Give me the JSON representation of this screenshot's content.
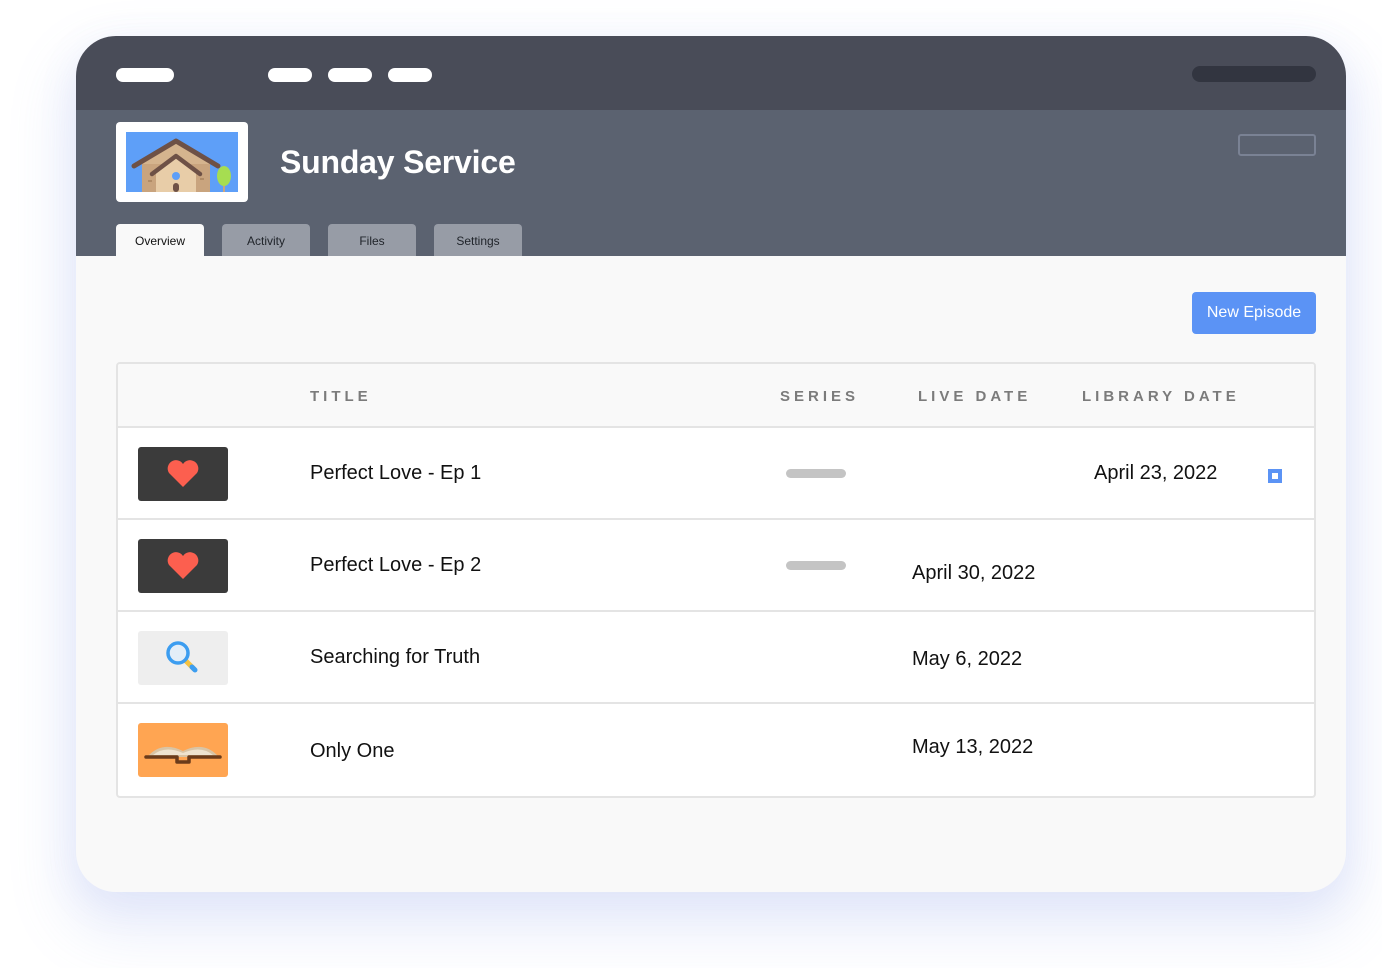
{
  "header": {
    "title": "Sunday Service",
    "thumbnail_icon": "house-icon"
  },
  "tabs": [
    {
      "label": "Overview",
      "active": true
    },
    {
      "label": "Activity",
      "active": false
    },
    {
      "label": "Files",
      "active": false
    },
    {
      "label": "Settings",
      "active": false
    }
  ],
  "actions": {
    "new_episode_label": "New Episode"
  },
  "table": {
    "columns": [
      "TITLE",
      "SERIES",
      "LIVE DATE",
      "LIBRARY DATE"
    ],
    "rows": [
      {
        "thumbnail_icon": "heart-icon",
        "title": "Perfect Love - Ep 1",
        "has_series": true,
        "live_date": "",
        "library_date": "April 23, 2022",
        "checked": true
      },
      {
        "thumbnail_icon": "heart-icon",
        "title": "Perfect Love - Ep 2",
        "has_series": true,
        "live_date": "April 30, 2022",
        "library_date": "",
        "checked": false
      },
      {
        "thumbnail_icon": "magnifier-icon",
        "title": "Searching for Truth",
        "has_series": false,
        "live_date": "May 6, 2022",
        "library_date": "",
        "checked": false
      },
      {
        "thumbnail_icon": "open-book-icon",
        "title": "Only One",
        "has_series": false,
        "live_date": "May 13, 2022",
        "library_date": "",
        "checked": false
      }
    ]
  },
  "colors": {
    "accent": "#5b93f5",
    "topbar": "#494c58",
    "header": "#5b6270",
    "heart": "#fc5f4f",
    "dark_thumb": "#3b3b3b",
    "orange_thumb": "#ffa552"
  }
}
